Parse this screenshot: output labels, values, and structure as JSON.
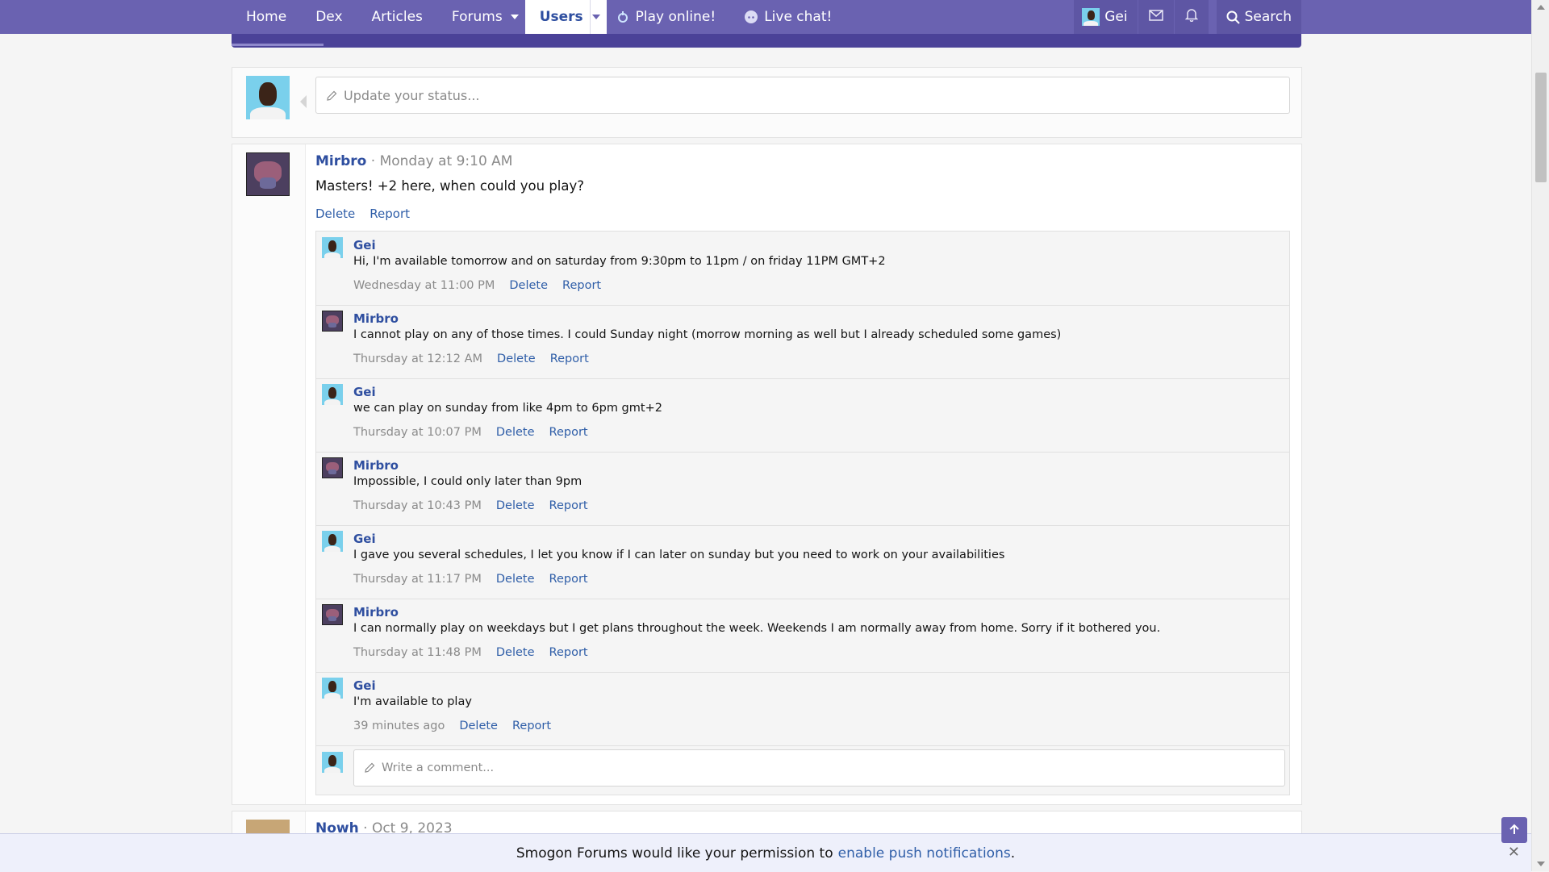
{
  "nav": {
    "tabs": [
      {
        "label": "Home"
      },
      {
        "label": "Dex"
      },
      {
        "label": "Articles"
      },
      {
        "label": "Forums"
      },
      {
        "label": "Users"
      },
      {
        "label": "Play online!"
      },
      {
        "label": "Live chat!"
      }
    ],
    "user_name": "Gei",
    "search_label": "Search"
  },
  "status": {
    "placeholder": "Update your status..."
  },
  "post": {
    "author": "Mirbro",
    "separator": "·",
    "time": "Monday at 9:10 AM",
    "body": "Masters! +2 here, when could you play?",
    "actions": [
      "Delete",
      "Report"
    ]
  },
  "comments": [
    {
      "author": "Gei",
      "text": "Hi, I'm available tomorrow and on saturday from 9:30pm to 11pm / on friday 11PM GMT+2",
      "time": "Wednesday at 11:00 PM",
      "actions": [
        "Delete",
        "Report"
      ]
    },
    {
      "author": "Mirbro",
      "text": "I cannot play on any of those times. I could Sunday night (morrow morning as well but I already scheduled some games)",
      "time": "Thursday at 12:12 AM",
      "actions": [
        "Delete",
        "Report"
      ]
    },
    {
      "author": "Gei",
      "text": "we can play on sunday from like 4pm to 6pm gmt+2",
      "time": "Thursday at 10:07 PM",
      "actions": [
        "Delete",
        "Report"
      ]
    },
    {
      "author": "Mirbro",
      "text": "Impossible, I could only later than 9pm",
      "time": "Thursday at 10:43 PM",
      "actions": [
        "Delete",
        "Report"
      ]
    },
    {
      "author": "Gei",
      "text": "I gave you several schedules, I let you know if I can later on sunday but you need to work on your availabilities",
      "time": "Thursday at 11:17 PM",
      "actions": [
        "Delete",
        "Report"
      ]
    },
    {
      "author": "Mirbro",
      "text": "I can normally play on weekdays but I get plans throughout the week. Weekends I am normally away from home. Sorry if it bothered you.",
      "time": "Thursday at 11:48 PM",
      "actions": [
        "Delete",
        "Report"
      ]
    },
    {
      "author": "Gei",
      "text": "I'm available to play",
      "time": "39 minutes ago",
      "actions": [
        "Delete",
        "Report"
      ]
    }
  ],
  "write_comment": {
    "placeholder": "Write a comment..."
  },
  "next_post": {
    "author": "Nowh",
    "separator": "·",
    "time": "Oct 9, 2023"
  },
  "notification": {
    "text_before": "Smogon Forums would like your permission to",
    "link": "enable push notifications",
    "text_after": "."
  },
  "colors": {
    "nav_bg": "#6a62b1",
    "link": "#2f5ea8",
    "username": "#2f4fa0"
  }
}
